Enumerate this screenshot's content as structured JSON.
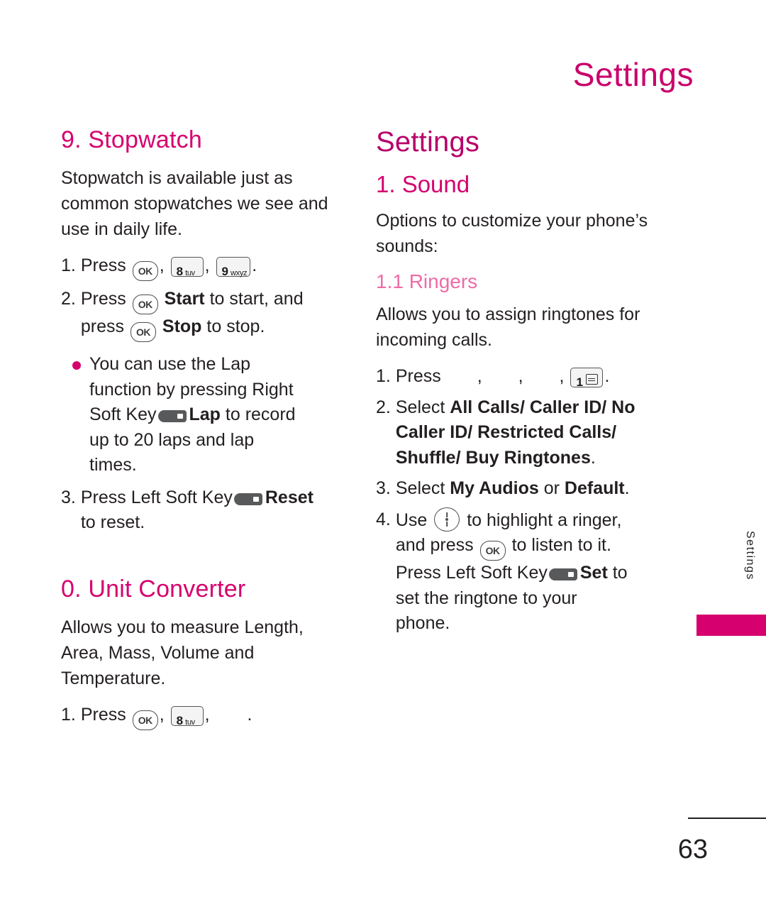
{
  "header": {
    "title": "Settings"
  },
  "left_column": {
    "section_stopwatch": {
      "title": "9. Stopwatch",
      "intro": "Stopwatch is available just as common stopwatches we see and use in daily life.",
      "steps": [
        {
          "num": "1.",
          "pre": "Press",
          "keys": [
            "OK",
            "8 tuv",
            "9 wxyz"
          ],
          "post": "."
        },
        {
          "num": "2.",
          "pre": "Press",
          "bold1": "Start",
          "mid": "to start, and",
          "line2_pre": "press",
          "bold2": "Stop",
          "line2_post": "to stop."
        },
        {
          "num": "3.",
          "text_pre": "Press Left Soft Key",
          "bold": "Reset",
          "text_post": "to reset."
        }
      ],
      "bullet": {
        "line1": "You can use the Lap",
        "line2": "function by pressing Right",
        "line3_pre": "Soft Key",
        "line3_bold": "Lap",
        "line3_post": "to record",
        "line4": "up to 20 laps and lap",
        "line5": "times."
      }
    },
    "section_unit_converter": {
      "title": "0. Unit Converter",
      "intro": "Allows you to measure Length, Area, Mass, Volume and Temperature.",
      "step": {
        "num": "1.",
        "pre": "Press",
        "keys": [
          "OK",
          "8 tuv"
        ],
        "post": ","
      }
    }
  },
  "right_column": {
    "title": "Settings",
    "section_sound": {
      "title": "1. Sound",
      "intro": "Options to customize your phone’s sounds:",
      "subsection": {
        "title": "1.1 Ringers",
        "intro": "Allows you to assign ringtones for incoming calls.",
        "steps": [
          {
            "num": "1.",
            "pre": "Press",
            "commas": [
              ",",
              ",",
              ","
            ],
            "key": "1",
            "post": "."
          },
          {
            "num": "2.",
            "pre": "Select",
            "bold_line1": "All Calls/ Caller ID/ No",
            "bold_line2": "Caller ID/ Restricted Calls/",
            "bold_line3": "Shuffle/ Buy Ringtones",
            "post": "."
          },
          {
            "num": "3.",
            "pre": "Select",
            "bold1": "My Audios",
            "mid": "or",
            "bold2": "Default",
            "post": "."
          },
          {
            "num": "4.",
            "pre": "Use",
            "mid1": "to highlight a ringer,",
            "line2_pre": "and press",
            "line2_post": "to listen to it.",
            "line3_pre": "Press Left Soft Key",
            "line3_bold": "Set",
            "line3_post": "to",
            "line4": "set the ringtone to your",
            "line5": "phone."
          }
        ]
      }
    }
  },
  "side_tab": {
    "label": "Settings"
  },
  "footer": {
    "page_number": "63"
  },
  "icons": {
    "ok_key": "OK",
    "digit_8": "8",
    "letters_8": "tuv",
    "digit_9": "9",
    "letters_9": "wxyz",
    "digit_1": "1"
  },
  "colors": {
    "magenta": "#d6006e",
    "light_magenta": "#ef6ba6",
    "header_magenta": "#c9006b",
    "text": "#231f20"
  }
}
